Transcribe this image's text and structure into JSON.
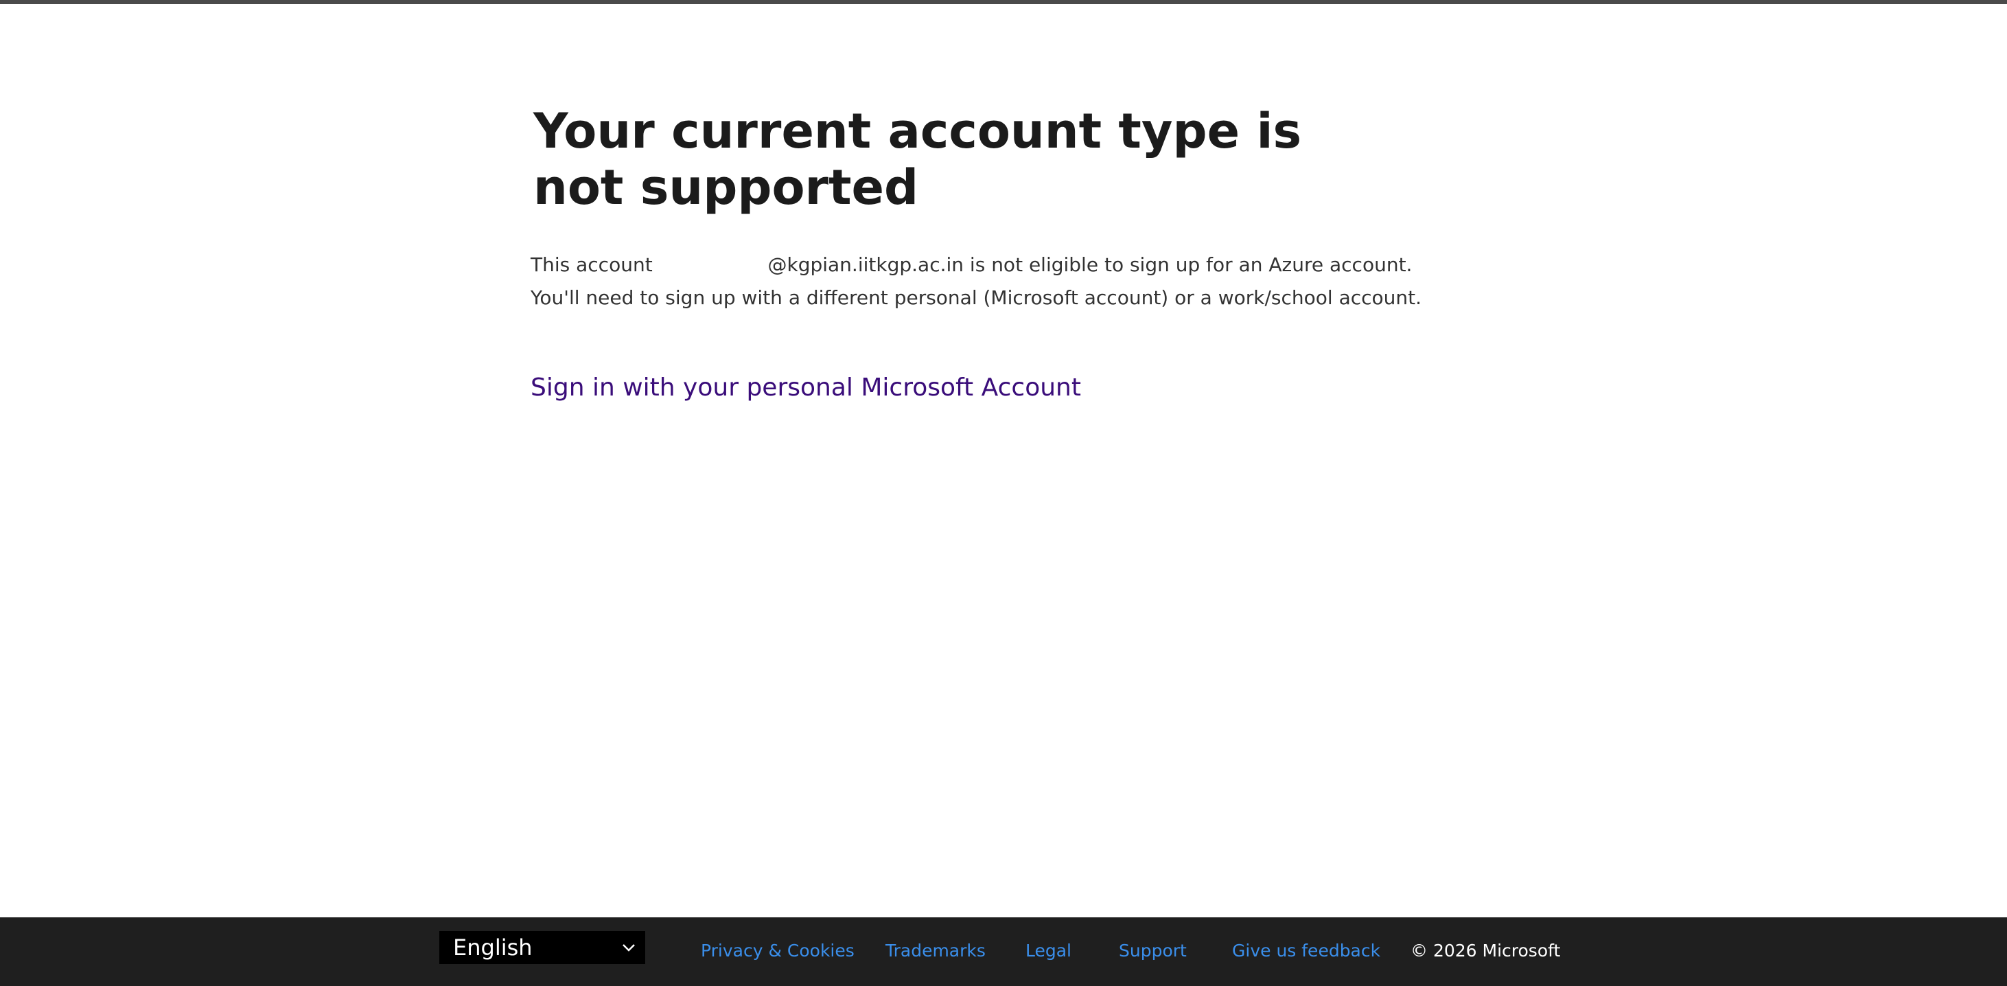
{
  "page": {
    "title": "Your current account type is not supported",
    "message_prefix": "This account",
    "message_email_domain": "@kgpian.iitkgp.ac.in",
    "message_suffix": "is not eligible to sign up for an Azure account. You'll need to sign up with a different personal (Microsoft account) or a work/school account.",
    "signin_link": "Sign in with your personal Microsoft Account"
  },
  "footer": {
    "language": "English",
    "links": [
      {
        "label": "Privacy & Cookies"
      },
      {
        "label": "Trademarks"
      },
      {
        "label": "Legal"
      },
      {
        "label": "Support"
      },
      {
        "label": "Give us feedback"
      }
    ],
    "copyright": "© 2026 Microsoft"
  },
  "colors": {
    "link": "#3a0d7a",
    "footer_link": "#3a8eea",
    "footer_bg": "#1f1f1f",
    "top_bar": "#4b4b4b"
  },
  "icons": {
    "language_dropdown": "chevron-down-icon"
  }
}
